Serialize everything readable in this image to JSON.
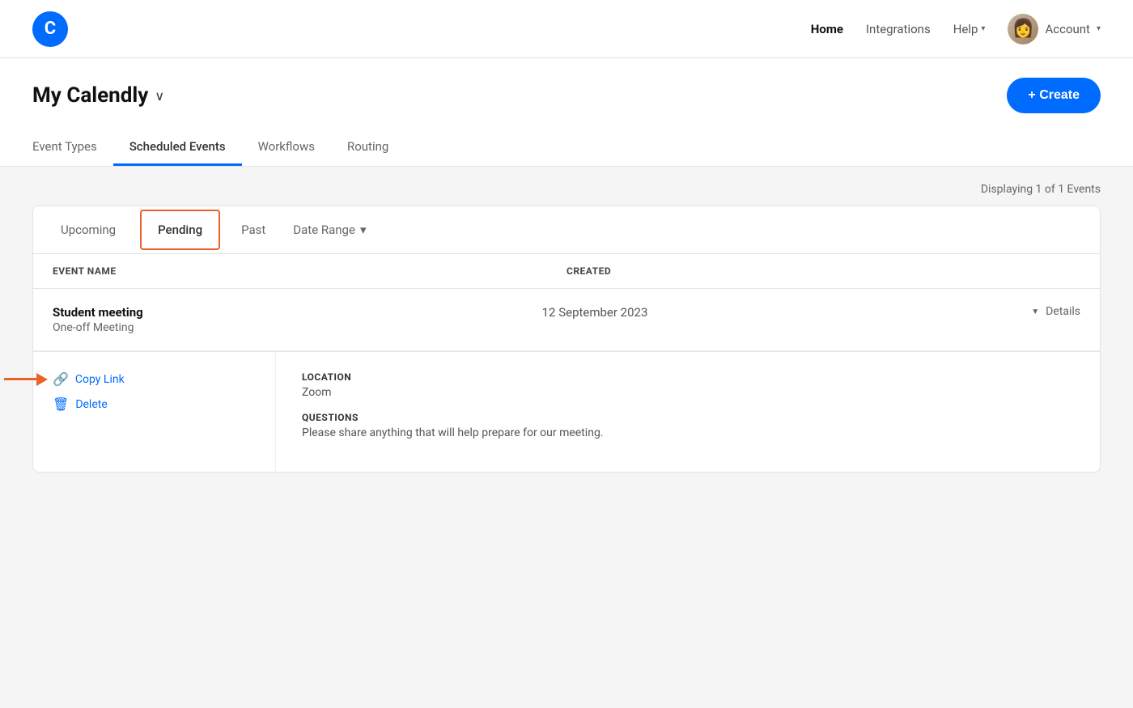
{
  "header": {
    "logo_text": "C",
    "nav": {
      "home": "Home",
      "integrations": "Integrations",
      "help": "Help",
      "account": "Account"
    },
    "avatar_emoji": "👩"
  },
  "page": {
    "title": "My Calendly",
    "create_label": "+ Create"
  },
  "tabs": [
    {
      "id": "event-types",
      "label": "Event Types",
      "active": false
    },
    {
      "id": "scheduled-events",
      "label": "Scheduled Events",
      "active": true
    },
    {
      "id": "workflows",
      "label": "Workflows",
      "active": false
    },
    {
      "id": "routing",
      "label": "Routing",
      "active": false
    }
  ],
  "display_count": "Displaying 1 of 1 Events",
  "filter_tabs": [
    {
      "id": "upcoming",
      "label": "Upcoming",
      "active": false
    },
    {
      "id": "pending",
      "label": "Pending",
      "active_orange": true
    },
    {
      "id": "past",
      "label": "Past",
      "active": false
    }
  ],
  "date_range": "Date Range",
  "table_headers": {
    "event_name": "EVENT NAME",
    "created": "CREATED"
  },
  "events": [
    {
      "name": "Student meeting",
      "type": "One-off Meeting",
      "created": "12 September 2023",
      "details_label": "Details"
    }
  ],
  "expanded": {
    "copy_link_label": "Copy Link",
    "copy_link_icon": "🔗",
    "delete_label": "Delete",
    "delete_icon": "🗑",
    "location_label": "LOCATION",
    "location_value": "Zoom",
    "questions_label": "QUESTIONS",
    "questions_value": "Please share anything that will help prepare for our meeting."
  }
}
